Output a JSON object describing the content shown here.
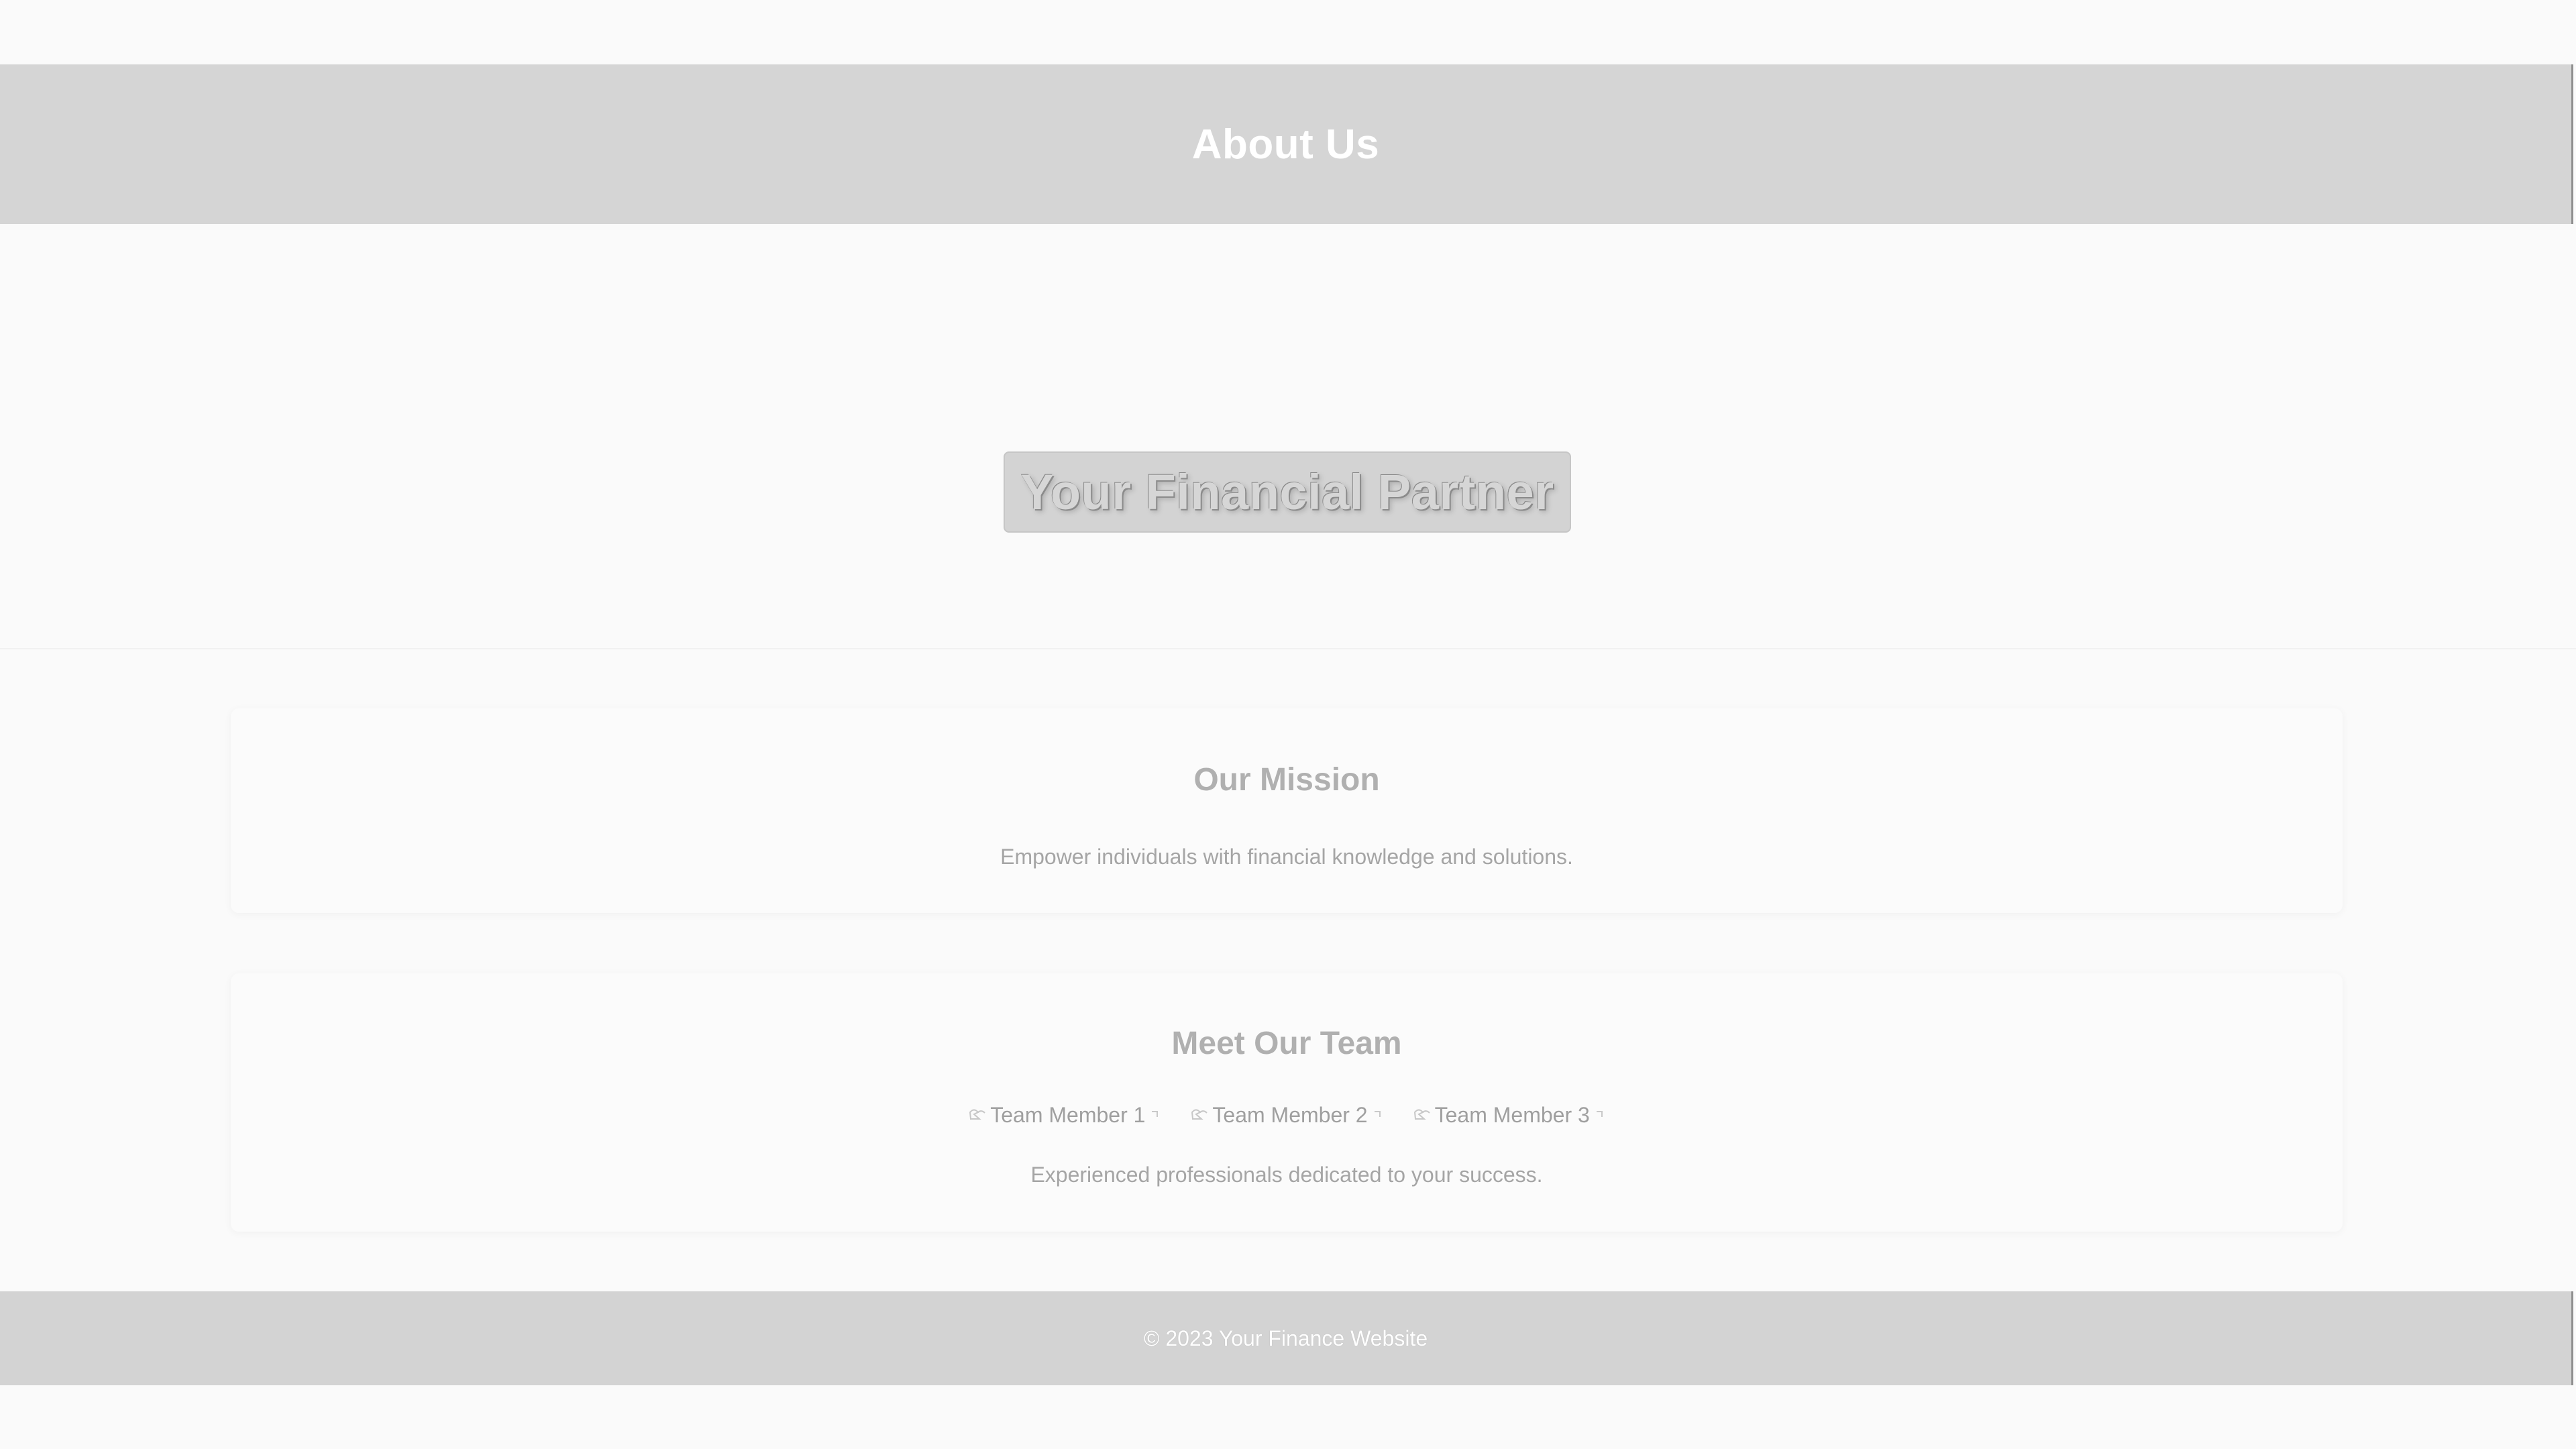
{
  "header": {
    "title": "About Us"
  },
  "hero": {
    "title": "Your Financial Partner"
  },
  "mission": {
    "heading": "Our Mission",
    "text": "Empower individuals with financial knowledge and solutions."
  },
  "team": {
    "heading": "Meet Our Team",
    "members": [
      {
        "label": "Team Member 1",
        "icon": "broken-image-icon"
      },
      {
        "label": "Team Member 2",
        "icon": "broken-image-icon"
      },
      {
        "label": "Team Member 3",
        "icon": "broken-image-icon"
      }
    ],
    "text": "Experienced professionals dedicated to your success."
  },
  "footer": {
    "text": "© 2023 Your Finance Website"
  },
  "colors": {
    "header_background": "#d5d5d5",
    "page_background": "#fafafa",
    "footer_background": "#d3d3d3",
    "hero_title_background": "#d3d3d3"
  }
}
